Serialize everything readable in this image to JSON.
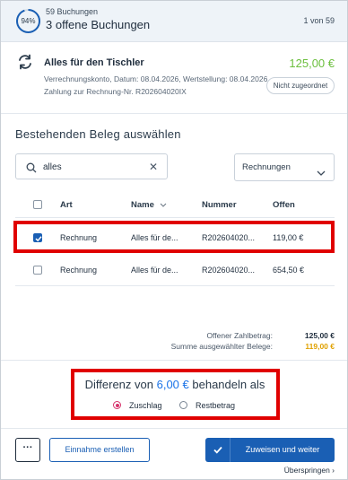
{
  "header": {
    "progress_percent": "94%",
    "progress_fraction": 0.94,
    "bookings_count": "59 Buchungen",
    "title": "3 offene Buchungen",
    "pager": "1 von 59"
  },
  "booking": {
    "icon": "swap-arrows-icon",
    "title": "Alles für den Tischler",
    "amount": "125,00 €",
    "meta_line1": "Verrechnungskonto, Datum: 08.04.2026, Wertstellung: 08.04.2026",
    "meta_line2": "Zahlung zur Rechnung-Nr. R202604020IX",
    "status": "Nicht zugeordnet"
  },
  "section_title": "Bestehenden Beleg auswählen",
  "search": {
    "value": "alles",
    "clear": "✕"
  },
  "filter": {
    "selected": "Rechnungen"
  },
  "table": {
    "columns": {
      "art": "Art",
      "name": "Name",
      "nummer": "Nummer",
      "offen": "Offen"
    },
    "rows": [
      {
        "checked": true,
        "art": "Rechnung",
        "name": "Alles für de...",
        "nummer": "R202604020...",
        "offen": "119,00 €"
      },
      {
        "checked": false,
        "art": "Rechnung",
        "name": "Alles für de...",
        "nummer": "R202604020...",
        "offen": "654,50 €"
      }
    ]
  },
  "totals": {
    "open_label": "Offener Zahlbetrag:",
    "open_value": "125,00 €",
    "sum_label": "Summe ausgewählter Belege:",
    "sum_value": "119,00 €"
  },
  "difference": {
    "prefix": "Differenz von",
    "amount": "6,00 €",
    "suffix": "behandeln als",
    "options": [
      "Zuschlag",
      "Restbetrag"
    ],
    "selected": "Zuschlag"
  },
  "footer": {
    "more_label": "···",
    "create_income": "Einnahme erstellen",
    "assign_continue": "Zuweisen und weiter",
    "skip": "Überspringen ›"
  },
  "colors": {
    "accent": "#1a5fb4",
    "amount_green": "#6cbf3e",
    "sum_orange": "#e0a100",
    "highlight_red": "#e00000",
    "radio_selected": "#d6336c"
  }
}
